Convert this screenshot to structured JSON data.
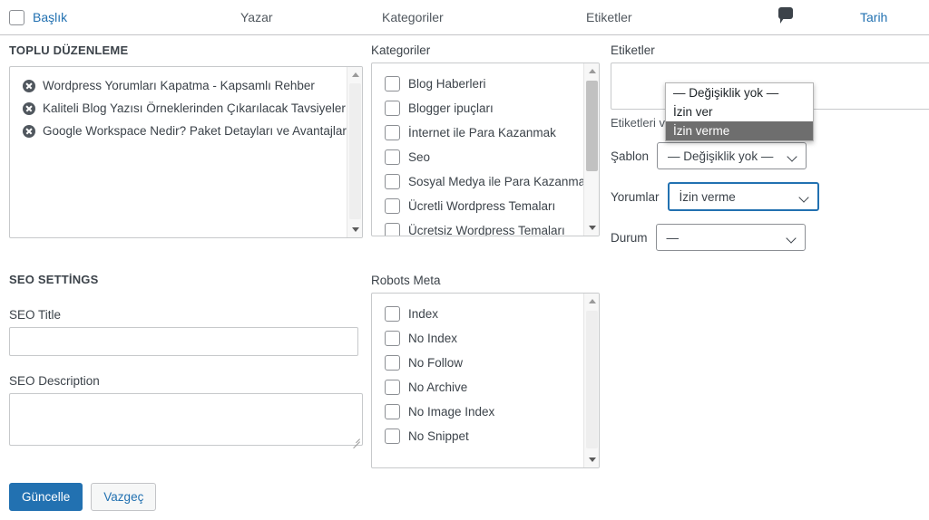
{
  "table_header": {
    "select_all_checkbox": "select-all",
    "columns": [
      {
        "label": "Başlık",
        "is_link": true
      },
      {
        "label": "Yazar",
        "is_link": false
      },
      {
        "label": "Kategoriler",
        "is_link": false
      },
      {
        "label": "Etiketler",
        "is_link": false
      },
      {
        "label": "",
        "is_link": false
      },
      {
        "label": "Tarih",
        "is_link": true
      }
    ],
    "comment_icon": "comment-bubble-icon"
  },
  "bulk_edit": {
    "title": "TOPLU DÜZENLEME",
    "items": [
      "Wordpress Yorumları Kapatma - Kapsamlı Rehber",
      "Kaliteli Blog Yazısı Örneklerinden Çıkarılacak Tavsiyeler",
      "Google Workspace Nedir? Paket Detayları ve Avantajları"
    ],
    "remove_icon": "remove-item-icon"
  },
  "categories": {
    "label": "Kategoriler",
    "items": [
      "Blog Haberleri",
      "Blogger ipuçları",
      "İnternet ile Para Kazanmak",
      "Seo",
      "Sosyal Medya ile Para Kazanmak",
      "Ücretli Wordpress Temaları",
      "Ücretsiz Wordpress Temaları"
    ]
  },
  "tags": {
    "label": "Etiketler",
    "value": "",
    "placeholder": "",
    "hint": "Etiketleri virgül ile ayırın"
  },
  "template_select": {
    "label": "Şablon",
    "value": "— Değişiklik yok —"
  },
  "comments_select": {
    "label": "Yorumlar",
    "value": "İzin verme",
    "open": true,
    "options": [
      {
        "label": "— Değişiklik yok —",
        "selected": false
      },
      {
        "label": "İzin ver",
        "selected": false
      },
      {
        "label": "İzin verme",
        "selected": true
      }
    ]
  },
  "status_select": {
    "label": "Durum",
    "value": "—"
  },
  "seo": {
    "title": "SEO SETTİNGS",
    "seo_title_label": "SEO Title",
    "seo_title_value": "",
    "seo_desc_label": "SEO Description",
    "seo_desc_value": ""
  },
  "robots_meta": {
    "label": "Robots Meta",
    "items": [
      "Index",
      "No Index",
      "No Follow",
      "No Archive",
      "No Image Index",
      "No Snippet"
    ]
  },
  "actions": {
    "update": "Güncelle",
    "cancel": "Vazgeç"
  },
  "colors": {
    "link": "#2271b1",
    "primary_button": "#2271b1",
    "text": "#3c434a",
    "border": "#c3c4c7",
    "option_highlight": "#6e6e6e"
  }
}
